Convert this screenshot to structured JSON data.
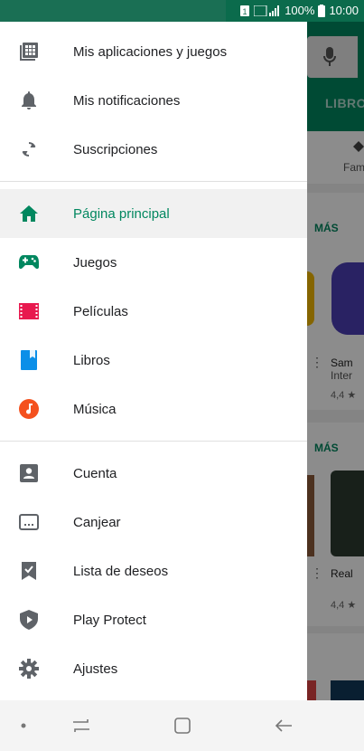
{
  "status_bar": {
    "battery": "100%",
    "time": "10:00"
  },
  "background": {
    "tab_label": "LIBRO",
    "category_label": "Fam",
    "more_label_1": "MÁS",
    "more_label_2": "MÁS",
    "card1_title": "Sam",
    "card1_subtitle": "Inter",
    "card1_rating": "4,4 ★",
    "card2_title": "Real",
    "card2_rating": "4,4 ★"
  },
  "drawer": {
    "group1": [
      {
        "label": "Mis aplicaciones y juegos",
        "icon": "apps-grid-icon"
      },
      {
        "label": "Mis notificaciones",
        "icon": "bell-icon"
      },
      {
        "label": "Suscripciones",
        "icon": "refresh-icon"
      }
    ],
    "group2": [
      {
        "label": "Página principal",
        "icon": "home-icon",
        "active": true
      },
      {
        "label": "Juegos",
        "icon": "gamepad-icon"
      },
      {
        "label": "Películas",
        "icon": "film-icon"
      },
      {
        "label": "Libros",
        "icon": "book-icon"
      },
      {
        "label": "Música",
        "icon": "music-icon"
      }
    ],
    "group3": [
      {
        "label": "Cuenta",
        "icon": "account-icon"
      },
      {
        "label": "Canjear",
        "icon": "redeem-icon"
      },
      {
        "label": "Lista de deseos",
        "icon": "wishlist-icon"
      },
      {
        "label": "Play Protect",
        "icon": "shield-icon"
      },
      {
        "label": "Ajustes",
        "icon": "gear-icon"
      }
    ]
  },
  "colors": {
    "accent_green": "#01875f",
    "movies_red": "#e8194f",
    "books_blue": "#0b8fe8",
    "music_orange": "#f4511e",
    "games_green": "#01875f",
    "icon_gray": "#5f6368"
  }
}
